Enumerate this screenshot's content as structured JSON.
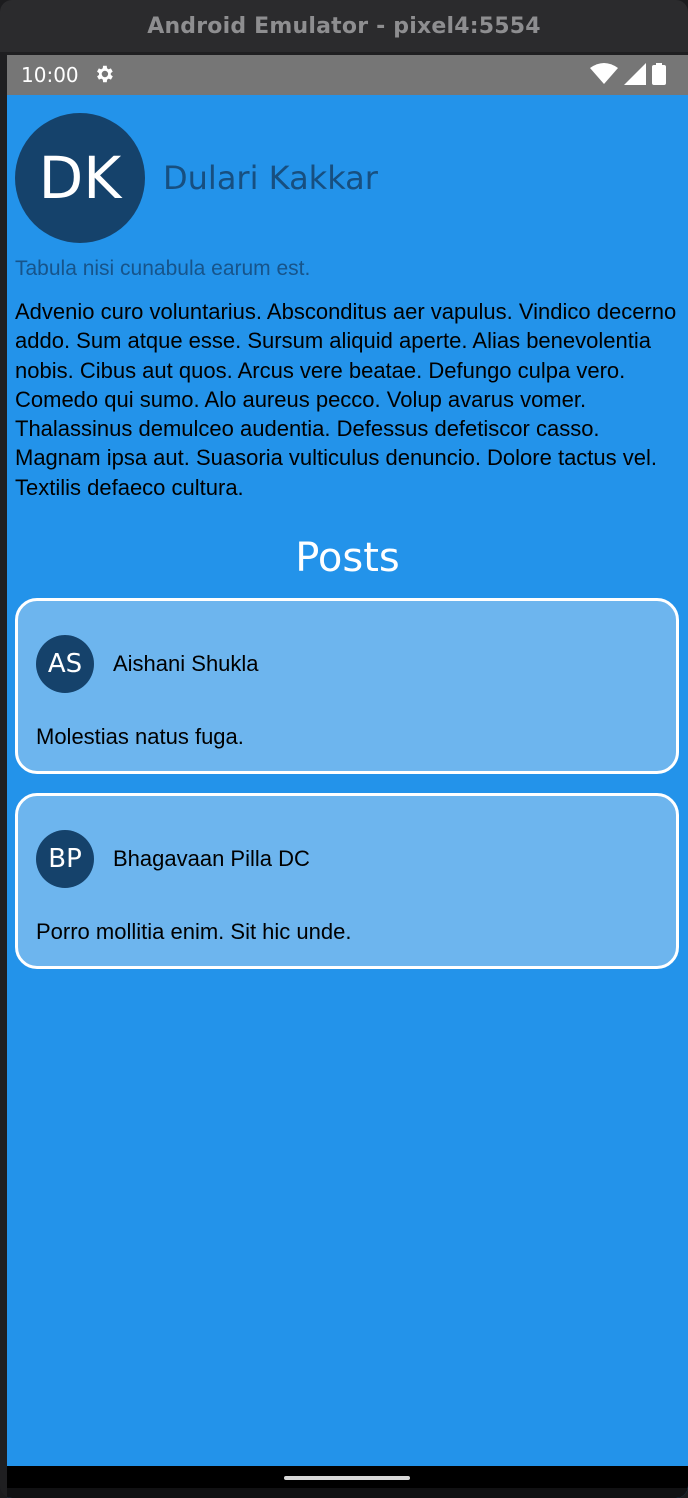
{
  "window": {
    "title": "Android Emulator - pixel4:5554"
  },
  "statusbar": {
    "time": "10:00",
    "icons": [
      "settings-gear-icon",
      "wifi-icon",
      "cellular-signal-icon",
      "battery-icon"
    ]
  },
  "profile": {
    "initials": "DK",
    "name": "Dulari Kakkar",
    "tagline": "Tabula nisi cunabula earum est.",
    "bio": "Advenio curo voluntarius. Absconditus aer vapulus. Vindico decerno addo. Sum atque esse. Sursum aliquid aperte. Alias benevolentia nobis. Cibus aut quos. Arcus vere beatae. Defungo culpa vero. Comedo qui sumo. Alo aureus pecco. Volup avarus vomer. Thalassinus demulceo audentia. Defessus defetiscor casso. Magnam ipsa aut. Suasoria vulticulus denuncio. Dolore tactus vel. Textilis defaeco cultura."
  },
  "posts": {
    "heading": "Posts",
    "items": [
      {
        "initials": "AS",
        "author": "Aishani Shukla",
        "body": "Molestias natus fuga."
      },
      {
        "initials": "BP",
        "author": "Bhagavaan Pilla DC",
        "body": "Porro mollitia enim. Sit hic unde."
      }
    ]
  },
  "colors": {
    "background": "#2393ea",
    "card": "#6db5ee",
    "avatar": "#15426b",
    "statusbar": "#767676"
  }
}
